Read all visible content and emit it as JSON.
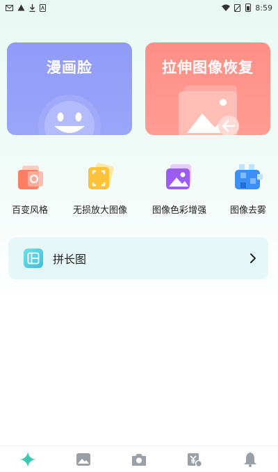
{
  "status_bar": {
    "time": "8:59",
    "notification_icons": [
      "mail-icon",
      "warning-icon",
      "download-icon",
      "app-icon"
    ],
    "system_icons": [
      "wifi-icon",
      "no-sim-icon",
      "battery-icon"
    ]
  },
  "cards": [
    {
      "title": "漫画脸",
      "color": "#8f9bf7",
      "icon": "smiley-face-icon"
    },
    {
      "title": "拉伸图像恢复",
      "color": "#ff8f86",
      "icon": "photo-restore-icon"
    }
  ],
  "tools": [
    {
      "label": "百变风格",
      "icon": "camera-style-icon"
    },
    {
      "label": "无损放大图像",
      "icon": "enlarge-frame-icon"
    },
    {
      "label": "图像色彩增强",
      "icon": "photo-enhance-icon"
    },
    {
      "label": "图像去雾",
      "icon": "mosaic-dehaze-icon"
    }
  ],
  "long_image": {
    "label": "拼长图",
    "icon": "collage-icon"
  },
  "bottom_nav": [
    {
      "icon": "sparkle-icon",
      "active": true,
      "color": "#3cc8b0"
    },
    {
      "icon": "gallery-icon",
      "active": false
    },
    {
      "icon": "camera-icon",
      "active": false
    },
    {
      "icon": "yen-coupon-icon",
      "active": false
    },
    {
      "icon": "bell-icon",
      "active": false
    }
  ]
}
